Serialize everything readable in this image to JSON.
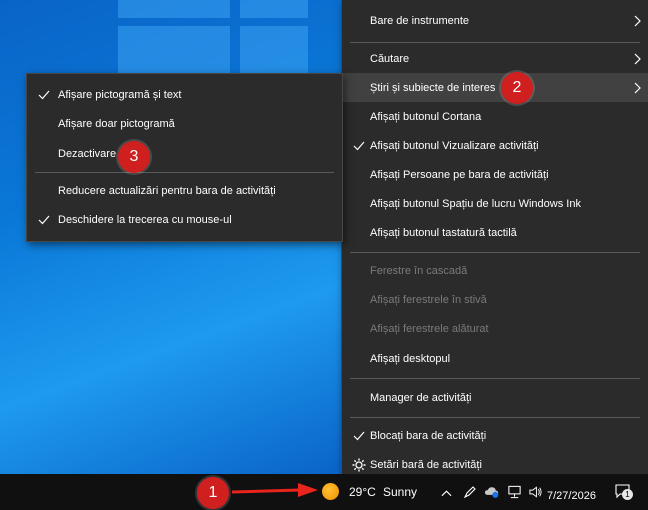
{
  "main_menu": {
    "items": [
      {
        "label": "Bare de instrumente",
        "submenu": true
      },
      {
        "label": "Căutare",
        "submenu": true
      },
      {
        "label": "Știri și subiecte de interes",
        "submenu": true
      },
      {
        "label": "Afișați butonul Cortana"
      },
      {
        "label": "Afișați butonul Vizualizare activități",
        "checked": true
      },
      {
        "label": "Afișați Persoane pe bara de activități"
      },
      {
        "label": "Afișați butonul Spațiu de lucru Windows Ink"
      },
      {
        "label": "Afișați butonul tastatură tactilă"
      },
      {
        "label": "Ferestre în cascadă",
        "disabled": true
      },
      {
        "label": "Afișați ferestrele în stivă",
        "disabled": true
      },
      {
        "label": "Afișați ferestrele alăturat",
        "disabled": true
      },
      {
        "label": "Afișați desktopul"
      },
      {
        "label": "Manager de activități"
      },
      {
        "label": "Blocați bara de activități",
        "checked": true
      },
      {
        "label": "Setări bară de activități"
      }
    ]
  },
  "sub_menu": {
    "items": [
      {
        "label": "Afișare pictogramă și text",
        "checked": true
      },
      {
        "label": "Afișare doar pictogramă"
      },
      {
        "label": "Dezactivare"
      },
      {
        "label": "Reducere actualizări pentru bara de activități"
      },
      {
        "label": "Deschidere la trecerea cu mouse-ul",
        "checked": true
      }
    ]
  },
  "badges": [
    "1",
    "2",
    "3"
  ],
  "taskbar": {
    "weather_temp": "29°C",
    "weather_text": "Sunny",
    "date": "7/27/2026",
    "notification_count": "1"
  },
  "colors": {
    "menu_bg": "#2b2b2b",
    "highlight": "#414141",
    "badge": "#d01f1f",
    "arrow": "#e8241c",
    "taskbar": "#101010"
  }
}
